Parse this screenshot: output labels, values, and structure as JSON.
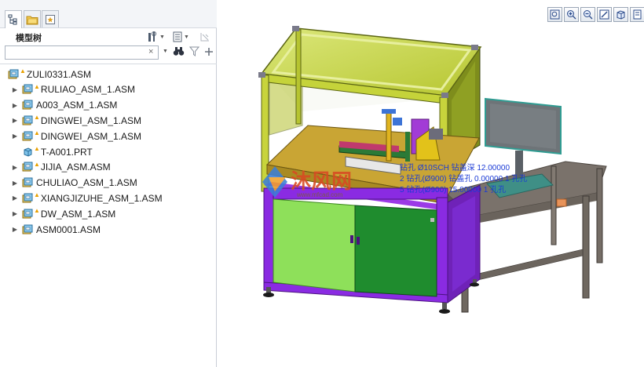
{
  "model_tree": {
    "title": "模型树",
    "search": {
      "value": "",
      "placeholder": "",
      "clear_glyph": "×"
    },
    "items": [
      {
        "label": "ZULI0331.ASM",
        "icon": "assembly-icon",
        "level": 0,
        "expandable": false,
        "flag": true
      },
      {
        "label": "RULIAO_ASM_1.ASM",
        "icon": "assembly-icon",
        "level": 1,
        "expandable": true,
        "flag": true
      },
      {
        "label": "A003_ASM_1.ASM",
        "icon": "assembly-icon",
        "level": 1,
        "expandable": true,
        "flag": false
      },
      {
        "label": "DINGWEI_ASM_1.ASM",
        "icon": "assembly-icon",
        "level": 1,
        "expandable": true,
        "flag": true
      },
      {
        "label": "DINGWEI_ASM_1.ASM",
        "icon": "assembly-icon",
        "level": 1,
        "expandable": true,
        "flag": true
      },
      {
        "label": "T-A001.PRT",
        "icon": "part-icon",
        "level": 1,
        "expandable": false,
        "flag": true
      },
      {
        "label": "JIJIA_ASM.ASM",
        "icon": "assembly-icon",
        "level": 1,
        "expandable": true,
        "flag": true
      },
      {
        "label": "CHULIAO_ASM_1.ASM",
        "icon": "assembly-icon",
        "level": 1,
        "expandable": true,
        "flag": false
      },
      {
        "label": "XIANGJIZUHE_ASM_1.ASM",
        "icon": "assembly-icon",
        "level": 1,
        "expandable": true,
        "flag": true
      },
      {
        "label": "DW_ASM_1.ASM",
        "icon": "assembly-icon",
        "level": 1,
        "expandable": true,
        "flag": true
      },
      {
        "label": "ASM0001.ASM",
        "icon": "assembly-icon",
        "level": 1,
        "expandable": true,
        "flag": false
      }
    ]
  },
  "viewport": {
    "watermark_text": "沐风网",
    "watermark_url": "www.mfcad.com",
    "annotations": [
      "钻孔 Ø10SCH 钻盖深 12.00000",
      "2 钻孔(Ø900) 钻盖孔 0.00000 1 孔孔",
      "5 钻孔(Ø900) 15.00000 1 孔孔"
    ]
  },
  "colors": {
    "panel_bg": "#ffffff",
    "frame_purple": "#8a2be2",
    "door_light_green": "#8ee05a",
    "door_dark_green": "#1f8c2e",
    "hood_olive": "#b5c22c",
    "table_top": "#7c746c",
    "annotation_blue": "#1b3bd6"
  }
}
